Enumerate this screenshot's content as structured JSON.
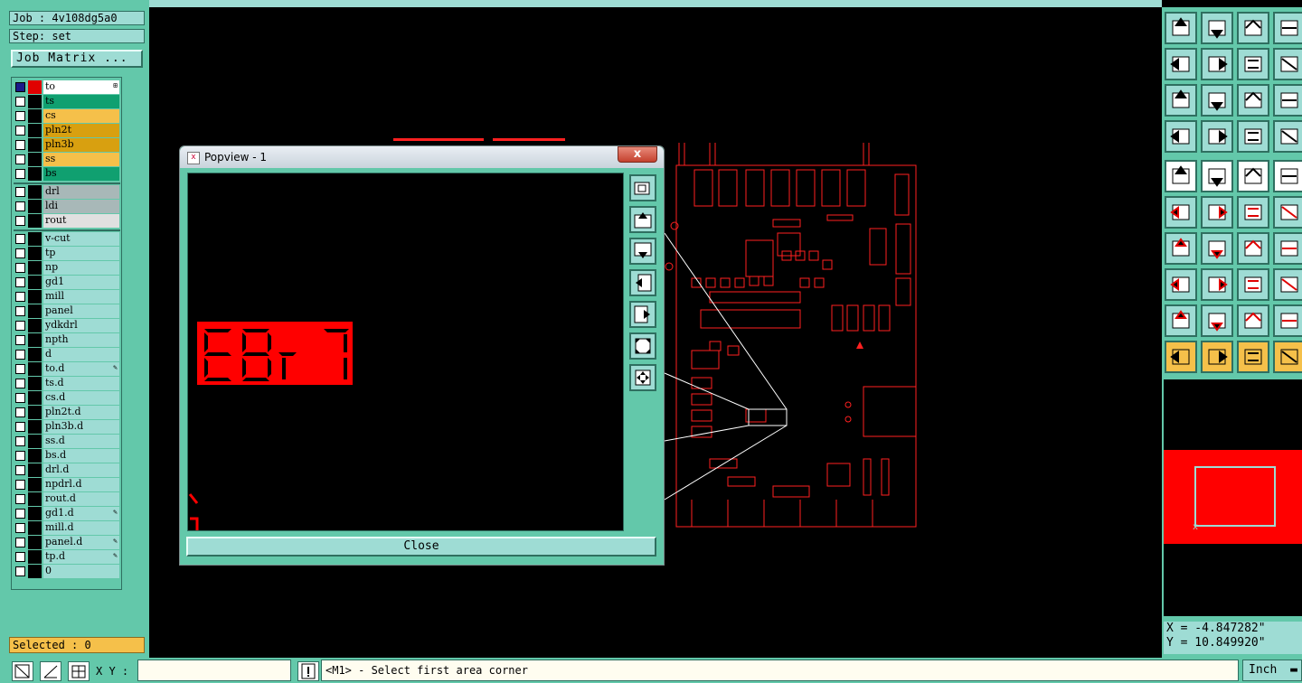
{
  "header": {
    "job": "Job : 4v108dg5a0",
    "step": "Step: set",
    "job_matrix_label": "Job Matrix ..."
  },
  "layers": [
    {
      "name": "to",
      "color": "#ffffff",
      "selected": true
    },
    {
      "name": "ts",
      "color": "#10a070"
    },
    {
      "name": "cs",
      "color": "#f5c04a"
    },
    {
      "name": "pln2t",
      "color": "#d8a010"
    },
    {
      "name": "pln3b",
      "color": "#d8a010"
    },
    {
      "name": "ss",
      "color": "#f5c04a"
    },
    {
      "name": "bs",
      "color": "#10a070"
    },
    {
      "name": "drl",
      "color": "#a8b8b8"
    },
    {
      "name": "ldi",
      "color": "#a8b8b8"
    },
    {
      "name": "rout",
      "color": "#e0e0e0"
    },
    {
      "name": "v-cut",
      "color": "#9edcd4"
    },
    {
      "name": "tp",
      "color": "#9edcd4"
    },
    {
      "name": "np",
      "color": "#9edcd4"
    },
    {
      "name": "gd1",
      "color": "#9edcd4"
    },
    {
      "name": "mill",
      "color": "#9edcd4"
    },
    {
      "name": "panel",
      "color": "#9edcd4"
    },
    {
      "name": "ydkdrl",
      "color": "#9edcd4"
    },
    {
      "name": "npth",
      "color": "#9edcd4"
    },
    {
      "name": "d",
      "color": "#9edcd4"
    },
    {
      "name": "to.d",
      "color": "#9edcd4",
      "flag": true
    },
    {
      "name": "ts.d",
      "color": "#9edcd4"
    },
    {
      "name": "cs.d",
      "color": "#9edcd4"
    },
    {
      "name": "pln2t.d",
      "color": "#9edcd4"
    },
    {
      "name": "pln3b.d",
      "color": "#9edcd4"
    },
    {
      "name": "ss.d",
      "color": "#9edcd4"
    },
    {
      "name": "bs.d",
      "color": "#9edcd4"
    },
    {
      "name": "drl.d",
      "color": "#9edcd4"
    },
    {
      "name": "npdrl.d",
      "color": "#9edcd4"
    },
    {
      "name": "rout.d",
      "color": "#9edcd4"
    },
    {
      "name": "gd1.d",
      "color": "#9edcd4",
      "flag": true
    },
    {
      "name": "mill.d",
      "color": "#9edcd4"
    },
    {
      "name": "panel.d",
      "color": "#9edcd4",
      "flag": true
    },
    {
      "name": "tp.d",
      "color": "#9edcd4",
      "flag": true
    },
    {
      "name": "0",
      "color": "#9edcd4"
    }
  ],
  "selected_count": "Selected : 0",
  "popview": {
    "title": "Popview - 1",
    "close_label": "Close",
    "close_x": "x"
  },
  "coords": {
    "x": "X = -4.847282\"",
    "y": "Y = 10.849920\""
  },
  "bottom": {
    "xy_label": "X Y :",
    "status": "<M1> - Select first area corner",
    "unit": "Inch"
  },
  "colors": {
    "panel": "#63c8aa",
    "panel_light": "#9edcd4",
    "feature": "#ff0000",
    "highlight": "#f5c04a"
  }
}
